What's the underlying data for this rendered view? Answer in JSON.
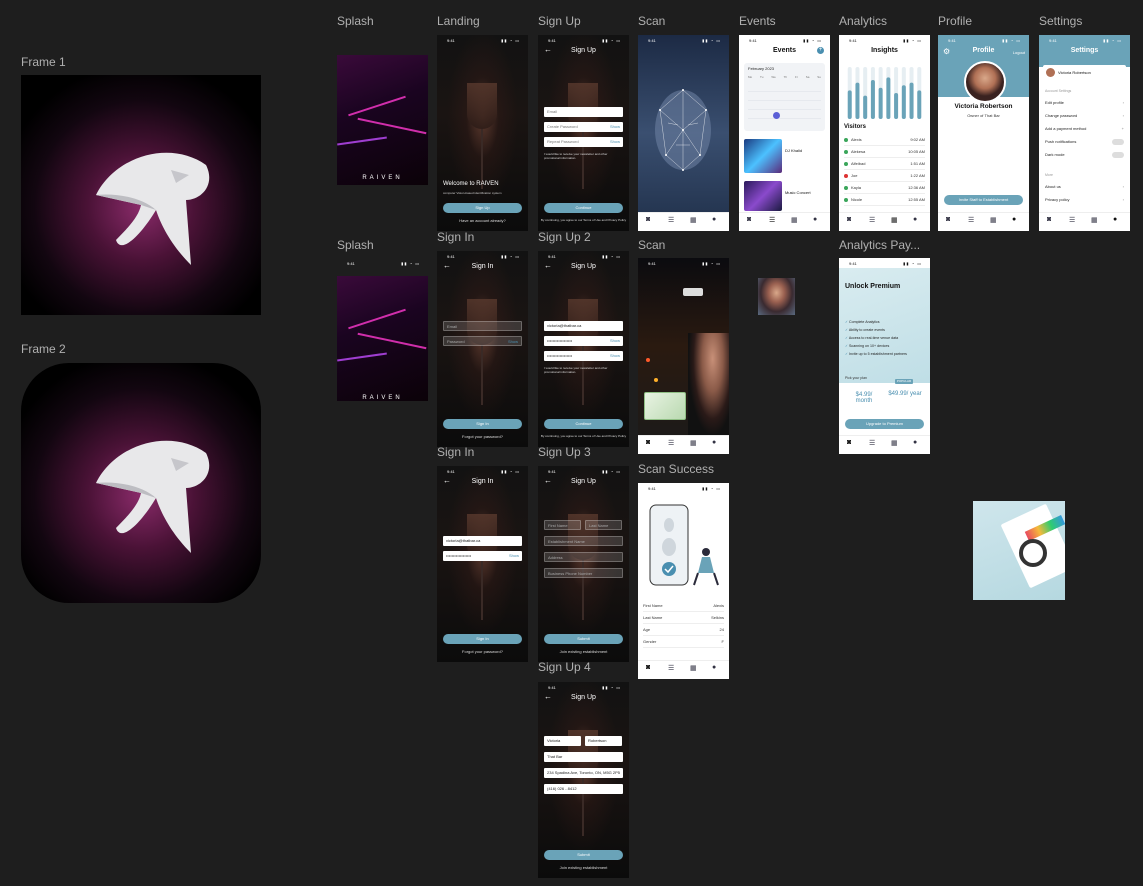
{
  "frames": {
    "frame1_label": "Frame 1",
    "frame2_label": "Frame 2"
  },
  "screens": {
    "splash": "Splash",
    "landing": "Landing",
    "signup": "Sign Up",
    "scan": "Scan",
    "events": "Events",
    "analytics": "Analytics",
    "profile": "Profile",
    "settings": "Settings",
    "splash2": "Splash",
    "signin": "Sign In",
    "signup2": "Sign Up 2",
    "scan2": "Scan",
    "analytics_pay": "Analytics Pay...",
    "signin2": "Sign In",
    "signup3": "Sign Up 3",
    "scan_success": "Scan Success",
    "signup4": "Sign Up 4"
  },
  "status_time": "9:41",
  "brand": "RAIVEN",
  "landing": {
    "welcome": "Welcome to RAIVEN",
    "sub": "computer Vision-based identification system",
    "signup_btn": "Sign Up",
    "have_account": "Have an account already?"
  },
  "signup": {
    "title": "Sign Up",
    "email": "Email",
    "password": "Create Password",
    "repeat": "Repeat Password",
    "show": "Show",
    "consent": "I would like to receive your newsletter and other promotional information.",
    "continue": "Continue",
    "terms": "By continuing, you agree to our Terms of Use and Privacy Policy"
  },
  "signin": {
    "title": "Sign In",
    "email": "Email",
    "password": "Password",
    "show": "Show",
    "btn": "Sign In",
    "forgot": "Forgot your password?",
    "email_value": "victoria@thatbar.ca",
    "password_value": "••••••••••••••••••"
  },
  "signup2": {
    "email_value": "victoria@thatbar.ca",
    "pw": "••••••••••••••••••",
    "continue": "Continue"
  },
  "signup3": {
    "first": "First Name",
    "last": "Last Name",
    "establishment": "Establishment Name",
    "address": "Address",
    "phone": "Business Phone Number",
    "submit": "Submit",
    "join": "Join existing establishment"
  },
  "signup4": {
    "first": "Victoria",
    "last": "Robertson",
    "establishment": "That Bar",
    "address": "234 Spadina Ave, Toronto, ON, M5G 2P5",
    "phone": "(416) 026 - 8412",
    "submit": "Submit",
    "join": "Join existing establishment"
  },
  "events": {
    "title": "Events",
    "month": "February 2023",
    "days": [
      "Mo",
      "Tu",
      "We",
      "Th",
      "Fr",
      "Sa",
      "Su"
    ],
    "event1": "DJ Khalid",
    "event2": "Music Concert"
  },
  "analytics": {
    "title": "Insights",
    "visitors_title": "Visitors",
    "visitors": [
      {
        "name": "Alexis",
        "time": "9:02 AM",
        "color": "#3aa65a"
      },
      {
        "name": "Alekesa",
        "time": "10:05 AM",
        "color": "#3aa65a"
      },
      {
        "name": "Alfeibad",
        "time": "1:51 AM",
        "color": "#3aa65a"
      },
      {
        "name": "Joe",
        "time": "1:22 AM",
        "color": "#d33"
      },
      {
        "name": "Kayla",
        "time": "12:36 AM",
        "color": "#3aa65a"
      },
      {
        "name": "Nicole",
        "time": "12:55 AM",
        "color": "#3aa65a"
      }
    ],
    "bars": [
      0.55,
      0.7,
      0.45,
      0.75,
      0.6,
      0.8,
      0.5,
      0.65,
      0.7,
      0.55
    ]
  },
  "profile": {
    "title": "Profile",
    "logout": "Logout",
    "name": "Victoria Robertson",
    "role": "Owner of That Bar",
    "invite": "Invite Staff to Establishment"
  },
  "settings": {
    "title": "Settings",
    "user": "Victoria Robertson",
    "section1": "Account Settings",
    "items": [
      "Edit profile",
      "Change password",
      "Add a payment method",
      "Push notifications",
      "Dark mode"
    ],
    "section2": "More",
    "more": [
      "About us",
      "Privacy policy"
    ]
  },
  "pay": {
    "title": "Unlock Premium",
    "features": [
      "Complete Analytics",
      "Ability to create events",
      "Access to real-time venue data",
      "Scanning on 10+ devices",
      "Invite up to 5 establishment partners"
    ],
    "pick": "Pick your plan",
    "popular": "POPULAR",
    "monthly": "$4.99/ month",
    "yearly": "$49.99/ year",
    "upgrade": "Upgrade to Premium"
  },
  "scan_success": {
    "rows": [
      {
        "k": "First Name",
        "v": "Alexis"
      },
      {
        "k": "Last Name",
        "v": "Selkins"
      },
      {
        "k": "Age",
        "v": "24"
      },
      {
        "k": "Gender",
        "v": "F"
      }
    ]
  },
  "colors": {
    "accent": "#6aa3b8",
    "bg": "#1e1e1e"
  }
}
